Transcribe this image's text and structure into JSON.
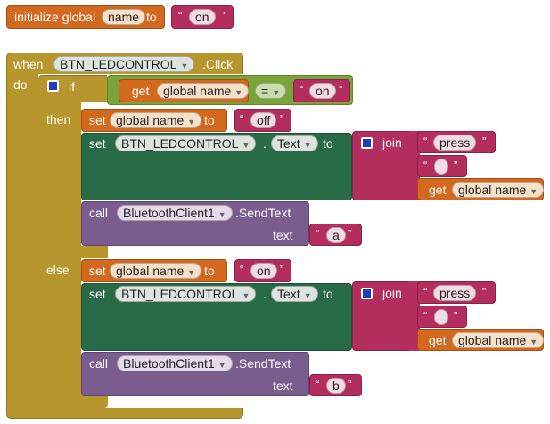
{
  "colors": {
    "variables": "#d2691e",
    "text": "#b32d5e",
    "control": "#b8962e",
    "logic": "#7aa33a",
    "component_setter": "#2a6b47",
    "component_method": "#7b5c8f"
  },
  "init_block": {
    "keyword": "initialize global",
    "var_name": "name",
    "to_label": "to",
    "value": "on"
  },
  "event_block": {
    "when_label": "when",
    "component": "BTN_LEDCONTROL",
    "event": ".Click",
    "do_label": "do"
  },
  "if_block": {
    "if_label": "if",
    "then_label": "then",
    "else_label": "else",
    "condition": {
      "get_label": "get",
      "var": "global name",
      "operator": "=",
      "value": "on"
    }
  },
  "then_branch": {
    "set_var": {
      "set_label": "set",
      "var": "global name",
      "to_label": "to",
      "value": "off"
    },
    "set_prop": {
      "set_label": "set",
      "component": "BTN_LEDCONTROL",
      "dot": ".",
      "property": "Text",
      "to_label": "to",
      "join_label": "join",
      "part1": "press",
      "part2": " ",
      "get_label": "get",
      "part3_var": "global name"
    },
    "call": {
      "call_label": "call",
      "component": "BluetoothClient1",
      "method": ".SendText",
      "arg_label": "text",
      "arg": "a"
    }
  },
  "else_branch": {
    "set_var": {
      "set_label": "set",
      "var": "global name",
      "to_label": "to",
      "value": "on"
    },
    "set_prop": {
      "set_label": "set",
      "component": "BTN_LEDCONTROL",
      "dot": ".",
      "property": "Text",
      "to_label": "to",
      "join_label": "join",
      "part1": "press",
      "part2": " ",
      "get_label": "get",
      "part3_var": "global name"
    },
    "call": {
      "call_label": "call",
      "component": "BluetoothClient1",
      "method": ".SendText",
      "arg_label": "text",
      "arg": "b"
    }
  }
}
